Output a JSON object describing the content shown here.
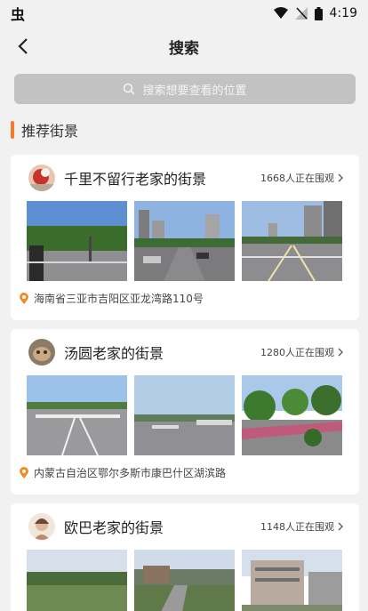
{
  "status_bar": {
    "time": "4:19",
    "left_icon": "bug-icon"
  },
  "nav": {
    "title": "搜索",
    "back_icon": "chevron-left-icon"
  },
  "search": {
    "placeholder": "搜索想要查看的位置",
    "icon": "search-icon"
  },
  "section": {
    "title": "推荐街景",
    "accent": "#f07d2c"
  },
  "cards": [
    {
      "title": "千里不留行老家的街景",
      "viewers": "1668人正在围观",
      "location": "海南省三亚市吉阳区亚龙湾路110号"
    },
    {
      "title": "汤圆老家的街景",
      "viewers": "1280人正在围观",
      "location": "内蒙古自治区鄂尔多斯市康巴什区湖滨路"
    },
    {
      "title": "欧巴老家的街景",
      "viewers": "1148人正在围观",
      "location": ""
    }
  ],
  "colors": {
    "background": "#f1f1f1",
    "search_bg": "#c2c2c2",
    "pin": "#f08a24"
  }
}
